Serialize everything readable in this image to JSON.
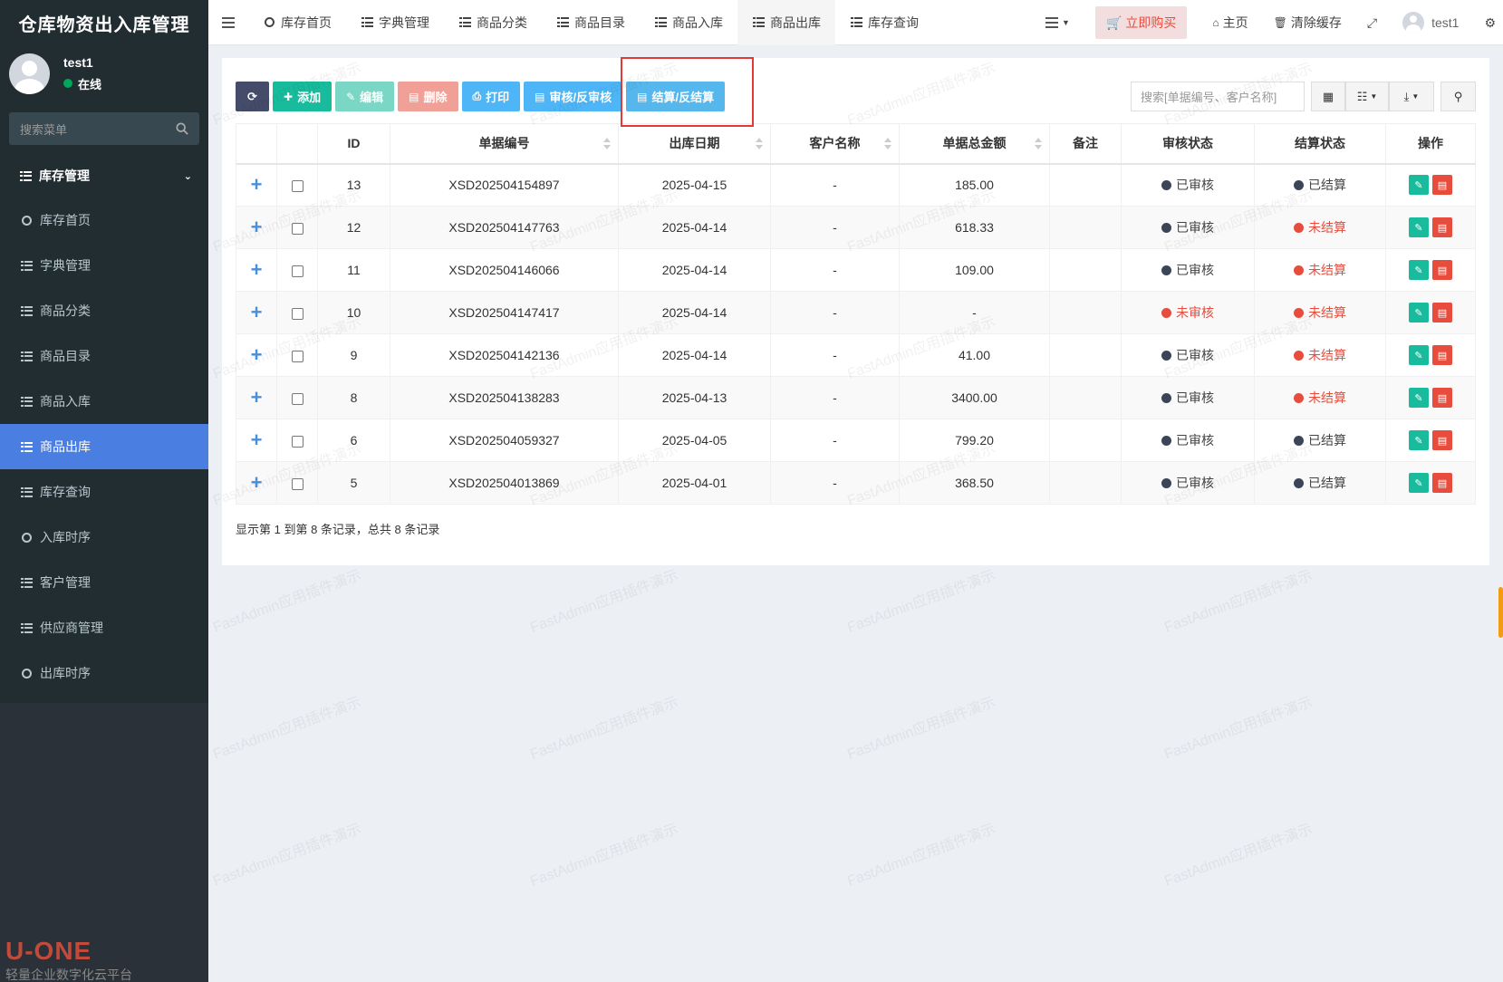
{
  "brand": "仓库物资出入库管理",
  "user": {
    "name": "test1",
    "status": "在线"
  },
  "sidebar": {
    "search_placeholder": "搜索菜单",
    "group": "库存管理",
    "items": [
      {
        "label": "库存首页",
        "icon": "circle-icon"
      },
      {
        "label": "字典管理",
        "icon": "list-icon"
      },
      {
        "label": "商品分类",
        "icon": "list-icon"
      },
      {
        "label": "商品目录",
        "icon": "list-icon"
      },
      {
        "label": "商品入库",
        "icon": "list-icon"
      },
      {
        "label": "商品出库",
        "icon": "list-icon",
        "active": true
      },
      {
        "label": "库存查询",
        "icon": "list-icon"
      },
      {
        "label": "入库时序",
        "icon": "circle-icon"
      },
      {
        "label": "客户管理",
        "icon": "list-icon"
      },
      {
        "label": "供应商管理",
        "icon": "list-icon"
      },
      {
        "label": "出库时序",
        "icon": "circle-icon"
      }
    ]
  },
  "topnav": {
    "tabs": [
      "库存首页",
      "字典管理",
      "商品分类",
      "商品目录",
      "商品入库",
      "商品出库",
      "库存查询"
    ],
    "buy": "立即购买",
    "home": "主页",
    "clear_cache": "清除缓存",
    "user": "test1"
  },
  "toolbar": {
    "add": "添加",
    "edit": "编辑",
    "delete": "删除",
    "print": "打印",
    "audit": "审核/反审核",
    "settle": "结算/反结算",
    "search_placeholder": "搜索[单据编号、客户名称]"
  },
  "table": {
    "headers": [
      "ID",
      "单据编号",
      "出库日期",
      "客户名称",
      "单据总金额",
      "备注",
      "审核状态",
      "结算状态",
      "操作"
    ],
    "rows": [
      {
        "id": "13",
        "no": "XSD202504154897",
        "date": "2025-04-15",
        "customer": "-",
        "amount": "185.00",
        "note": "",
        "audit": "已审核",
        "audit_ok": true,
        "settle": "已结算",
        "settle_ok": true
      },
      {
        "id": "12",
        "no": "XSD202504147763",
        "date": "2025-04-14",
        "customer": "-",
        "amount": "618.33",
        "note": "",
        "audit": "已审核",
        "audit_ok": true,
        "settle": "未结算",
        "settle_ok": false
      },
      {
        "id": "11",
        "no": "XSD202504146066",
        "date": "2025-04-14",
        "customer": "-",
        "amount": "109.00",
        "note": "",
        "audit": "已审核",
        "audit_ok": true,
        "settle": "未结算",
        "settle_ok": false
      },
      {
        "id": "10",
        "no": "XSD202504147417",
        "date": "2025-04-14",
        "customer": "-",
        "amount": "-",
        "note": "",
        "audit": "未审核",
        "audit_ok": false,
        "settle": "未结算",
        "settle_ok": false
      },
      {
        "id": "9",
        "no": "XSD202504142136",
        "date": "2025-04-14",
        "customer": "-",
        "amount": "41.00",
        "note": "",
        "audit": "已审核",
        "audit_ok": true,
        "settle": "未结算",
        "settle_ok": false
      },
      {
        "id": "8",
        "no": "XSD202504138283",
        "date": "2025-04-13",
        "customer": "-",
        "amount": "3400.00",
        "note": "",
        "audit": "已审核",
        "audit_ok": true,
        "settle": "未结算",
        "settle_ok": false
      },
      {
        "id": "6",
        "no": "XSD202504059327",
        "date": "2025-04-05",
        "customer": "-",
        "amount": "799.20",
        "note": "",
        "audit": "已审核",
        "audit_ok": true,
        "settle": "已结算",
        "settle_ok": true
      },
      {
        "id": "5",
        "no": "XSD202504013869",
        "date": "2025-04-01",
        "customer": "-",
        "amount": "368.50",
        "note": "",
        "audit": "已审核",
        "audit_ok": true,
        "settle": "已结算",
        "settle_ok": true
      }
    ],
    "footer": "显示第 1 到第 8 条记录，总共 8 条记录"
  },
  "watermark": "FastAdmin应用插件演示",
  "logo": {
    "mark": "U-ONE",
    "text": "轻量企业数字化云平台"
  }
}
